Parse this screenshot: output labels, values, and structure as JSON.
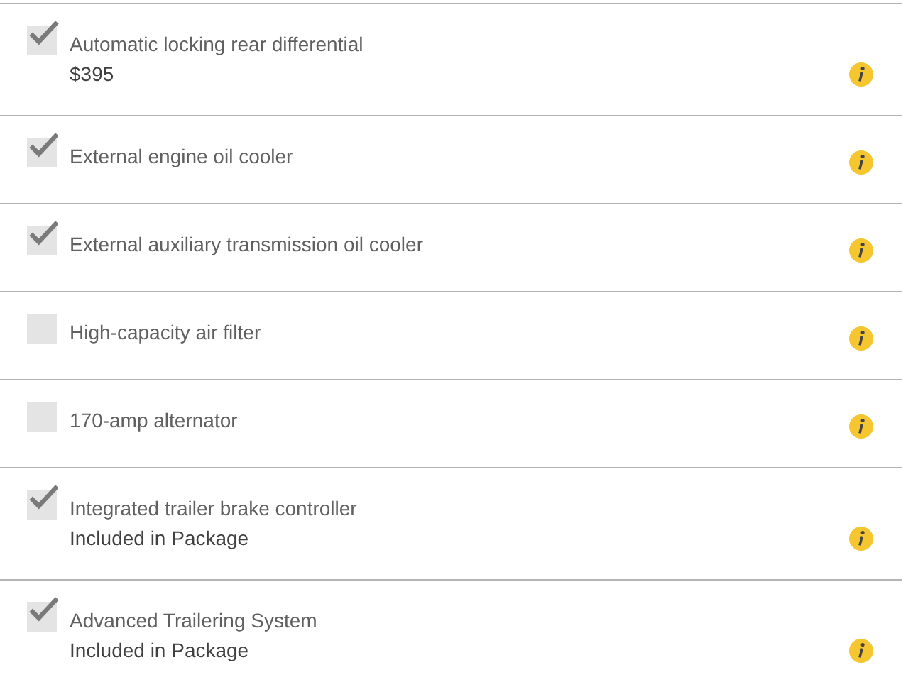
{
  "options": [
    {
      "label": "Automatic locking rear differential",
      "checked": true,
      "note": "$395"
    },
    {
      "label": "External engine oil cooler",
      "checked": true
    },
    {
      "label": "External auxiliary transmission oil cooler",
      "checked": true
    },
    {
      "label": "High-capacity air filter",
      "checked": false
    },
    {
      "label": "170-amp alternator",
      "checked": false
    },
    {
      "label": "Integrated trailer brake controller",
      "checked": true,
      "note": "Included in Package"
    },
    {
      "label": "Advanced Trailering System",
      "checked": true,
      "note": "Included in Package"
    }
  ]
}
